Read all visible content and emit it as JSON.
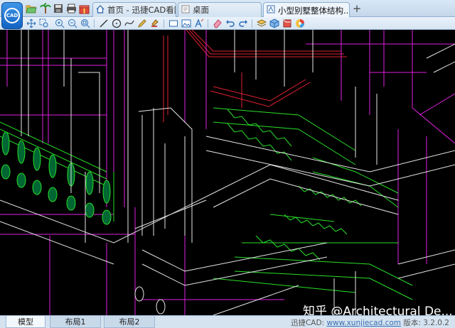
{
  "app": {
    "logo_text": "CAD"
  },
  "quick_access": [
    "open-folder-icon",
    "palm-tree-icon",
    "save-icon",
    "print-icon",
    "gift-icon"
  ],
  "tabs": [
    {
      "label": "首页 - 迅捷CAD看图",
      "icon": "home-icon",
      "active": false
    },
    {
      "label": "桌面",
      "icon": "document-icon",
      "active": false
    },
    {
      "label": "小型别墅整体结构...",
      "icon": "drawing-icon",
      "active": true
    }
  ],
  "new_tab_label": "+",
  "toolbar": [
    "pan-icon",
    "zoom-window-icon",
    "zoom-in-icon",
    "zoom-out-icon",
    "zoom-fit-icon",
    "line-icon",
    "circle-icon",
    "curve-icon",
    "pencil-icon",
    "stamp-icon",
    "rectangle-icon",
    "image-icon",
    "text-icon",
    "eraser-icon",
    "undo-icon",
    "redo-icon",
    "layers-icon",
    "cube-icon",
    "3d-view-icon",
    "color-wheel-icon"
  ],
  "layout_tabs": [
    {
      "label": "模型",
      "active": true
    },
    {
      "label": "布局1",
      "active": false
    },
    {
      "label": "布局2",
      "active": false
    }
  ],
  "status": {
    "prefix": "迅捷CAD: ",
    "link": "www.xunjiecad.com",
    "version": "版本: 3.2.0.2"
  },
  "watermark": "知乎 @Architectural De...",
  "colors": {
    "canvas_bg": "#000000",
    "line_white": "#e6e6e6",
    "line_magenta": "#e020e0",
    "line_green": "#28e028",
    "line_red": "#e02030"
  }
}
